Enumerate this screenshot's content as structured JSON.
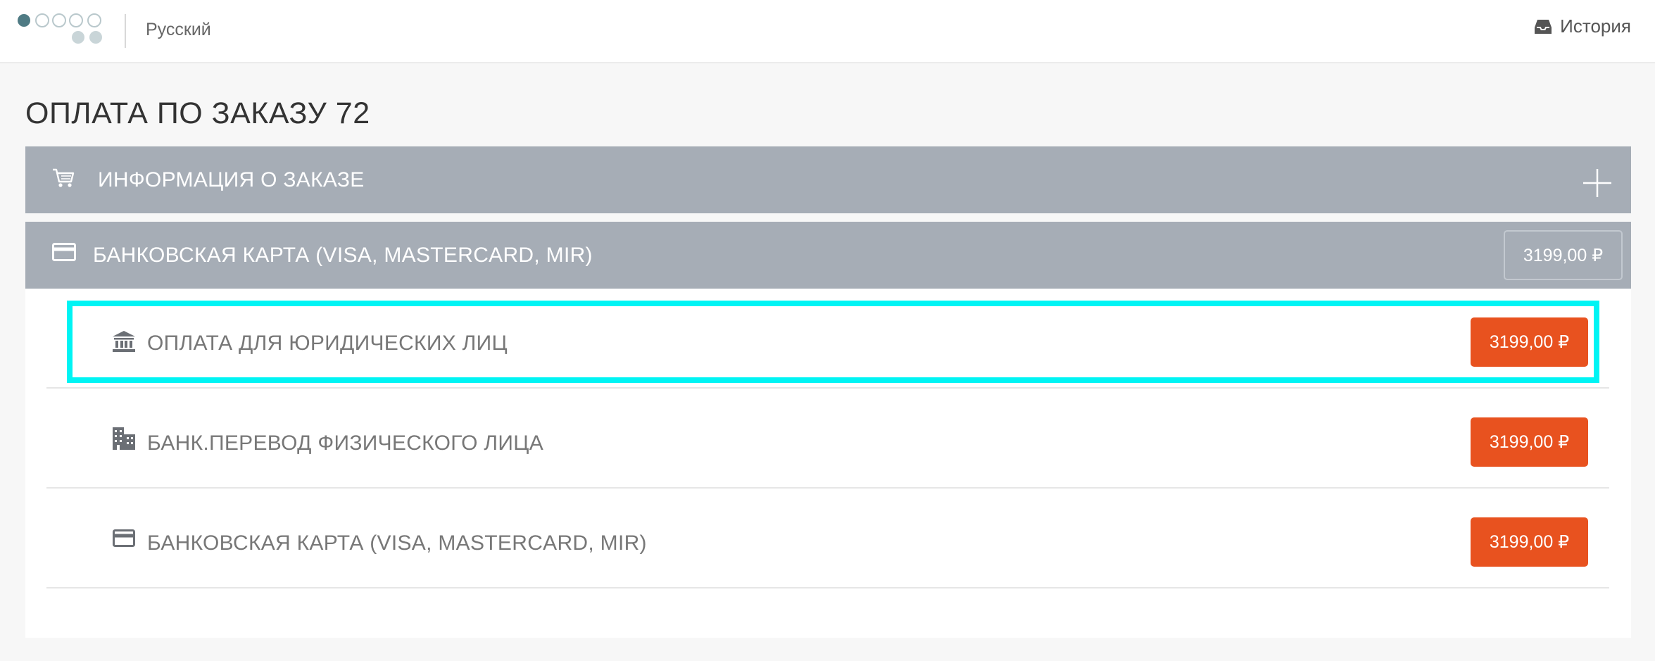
{
  "header": {
    "language": "Русский",
    "history_label": "История"
  },
  "page": {
    "title": "ОПЛАТА ПО ЗАКАЗУ 72"
  },
  "order_info": {
    "label": "ИНФОРМАЦИЯ О ЗАКАЗЕ"
  },
  "payment_group": {
    "label": "БАНКОВСКАЯ КАРТА (VISA, MASTERCARD, MIR)",
    "amount": "3199,00 ₽"
  },
  "methods": [
    {
      "icon": "bank-icon",
      "label": "ОПЛАТА ДЛЯ ЮРИДИЧЕСКИХ ЛИЦ",
      "amount": "3199,00 ₽",
      "highlighted": true
    },
    {
      "icon": "building-icon",
      "label": "БАНК.ПЕРЕВОД ФИЗИЧЕСКОГО ЛИЦА",
      "amount": "3199,00 ₽",
      "highlighted": false
    },
    {
      "icon": "credit-card-icon",
      "label": "БАНКОВСКАЯ КАРТА (VISA, MASTERCARD, MIR)",
      "amount": "3199,00 ₽",
      "highlighted": false
    }
  ],
  "colors": {
    "accent_button": "#e8521f",
    "panel_background": "#a6adb6",
    "highlight_outline": "#00f4f4",
    "logo_primary": "#4f7b84",
    "logo_secondary": "#c9d5d8"
  }
}
